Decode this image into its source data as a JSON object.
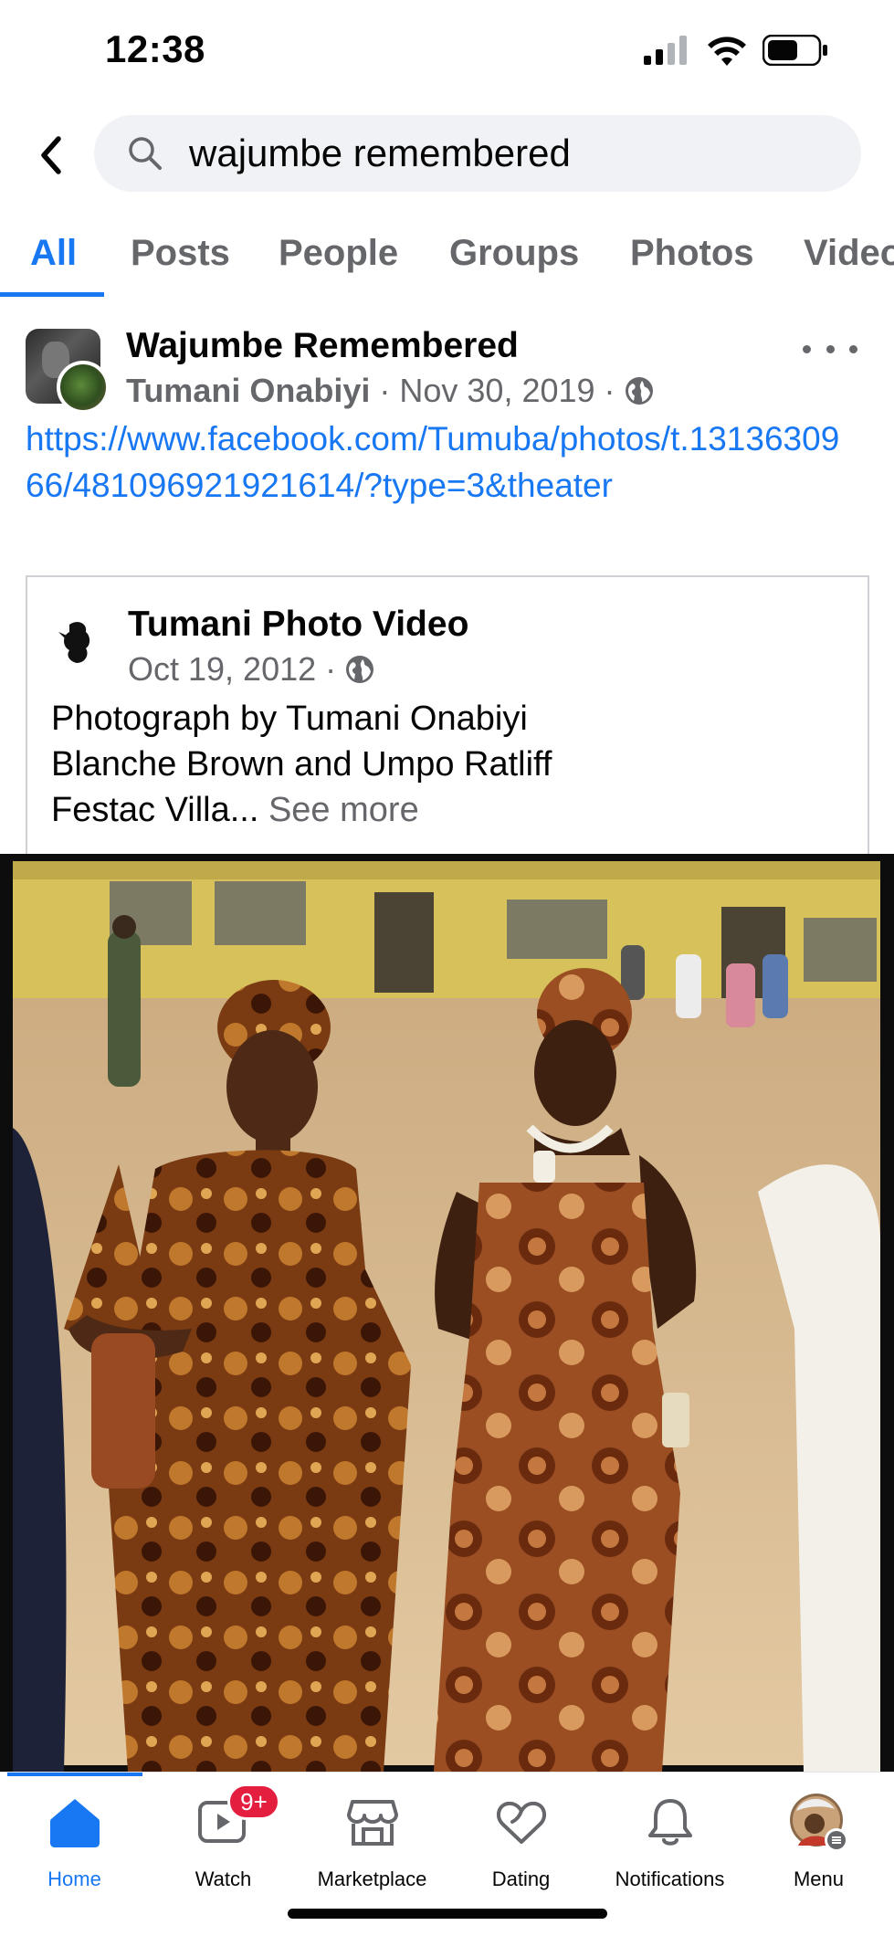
{
  "status_bar": {
    "time": "12:38"
  },
  "search": {
    "query": "wajumbe remembered"
  },
  "tabs": [
    {
      "label": "All",
      "active": true
    },
    {
      "label": "Posts",
      "active": false
    },
    {
      "label": "People",
      "active": false
    },
    {
      "label": "Groups",
      "active": false
    },
    {
      "label": "Photos",
      "active": false
    },
    {
      "label": "Videos",
      "active": false
    }
  ],
  "post": {
    "group_name": "Wajumbe Remembered",
    "author": "Tumani Onabiyi",
    "date": "Nov 30, 2019",
    "link": "https://www.facebook.com/Tumuba/photos/t.1313630966/481096921921614/?type=3&theater",
    "shared": {
      "name": "Tumani Photo Video",
      "date": "Oct 19, 2012",
      "text_line1": "Photograph by Tumani Onabiyi",
      "text_line2": "Blanche Brown and Umpo Ratliff",
      "text_line3": "Festac Villa...",
      "see_more": "See more"
    }
  },
  "bottom_nav": [
    {
      "label": "Home",
      "icon": "home-icon",
      "active": true
    },
    {
      "label": "Watch",
      "icon": "watch-icon",
      "badge": "9+"
    },
    {
      "label": "Marketplace",
      "icon": "marketplace-icon"
    },
    {
      "label": "Dating",
      "icon": "dating-icon"
    },
    {
      "label": "Notifications",
      "icon": "bell-icon"
    },
    {
      "label": "Menu",
      "icon": "menu-avatar-icon"
    }
  ],
  "colors": {
    "accent": "#1877f2",
    "badge": "#e41e3f",
    "secondary_text": "#65676b"
  }
}
